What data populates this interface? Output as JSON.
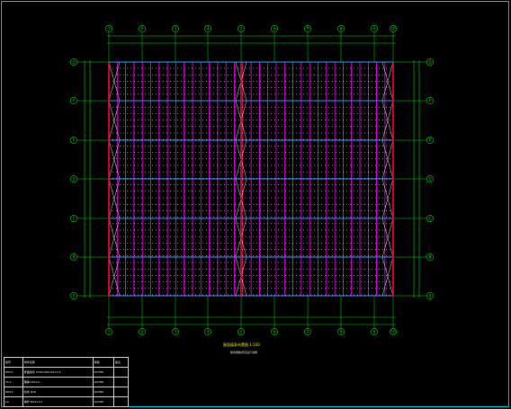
{
  "drawing": {
    "title": "屋面檩条布置图",
    "title_suffix": "1:100",
    "subtitle": "檩条规格详见设计说明"
  },
  "axes": {
    "x_labels": [
      "1",
      "2",
      "3",
      "4",
      "5",
      "6",
      "7",
      "8",
      "9",
      "10"
    ],
    "y_labels": [
      "A",
      "B",
      "C",
      "D",
      "E",
      "F",
      "G"
    ]
  },
  "colors": {
    "frame": "#00c8c8",
    "grid": "#00e000",
    "rafter": "#ff00ff",
    "main_beam": "#ff0033",
    "tie_bar": "#3399ff",
    "text": "#e8e8e8"
  },
  "table": {
    "headers": [
      "编号",
      "构件名称",
      "规格",
      "备注"
    ],
    "rows": [
      [
        "WLT-1",
        "屋面檩条 C160×60×20×2.5",
        "Q235B",
        ""
      ],
      [
        "YC-1",
        "隅撑 L50×4",
        "Q235B",
        ""
      ],
      [
        "WLT-2",
        "拉条 Φ10",
        "Q235B",
        ""
      ],
      [
        "LG",
        "撑杆 Φ32×2.5",
        "Q235B",
        ""
      ]
    ]
  }
}
